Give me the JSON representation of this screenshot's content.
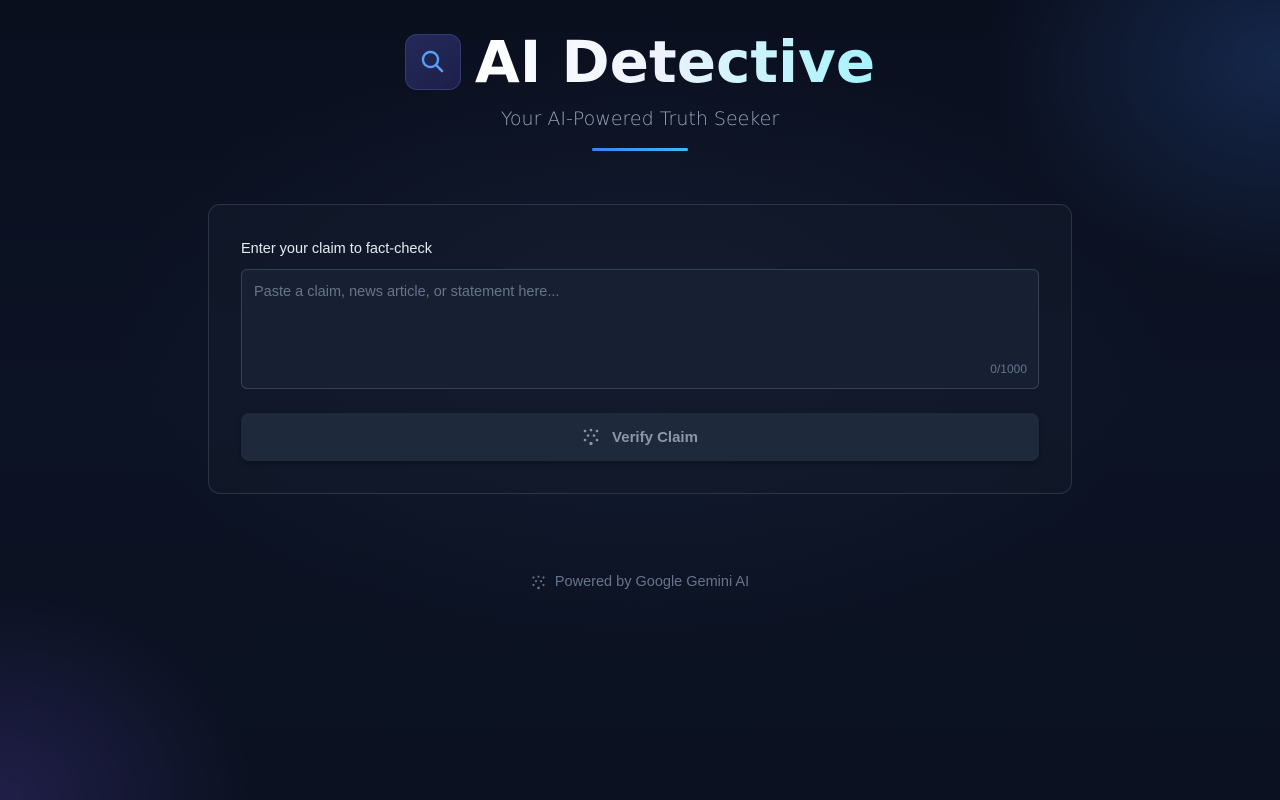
{
  "header": {
    "title": "AI Detective",
    "subtitle": "Your AI-Powered Truth Seeker",
    "logo_icon": "search-icon"
  },
  "form": {
    "label": "Enter your claim to fact-check",
    "claim": {
      "value": "",
      "placeholder": "Paste a claim, news article, or statement here..."
    },
    "char_count": "0/1000",
    "submit_label": "Verify Claim",
    "submit_icon": "sparkle-icon"
  },
  "footer": {
    "text": "Powered by Google Gemini AI",
    "icon": "sparkle-icon"
  },
  "colors": {
    "background": "#0b1120",
    "accent_start": "#3b82f6",
    "accent_end": "#38bdf8",
    "logo_bg": "#24295a"
  }
}
